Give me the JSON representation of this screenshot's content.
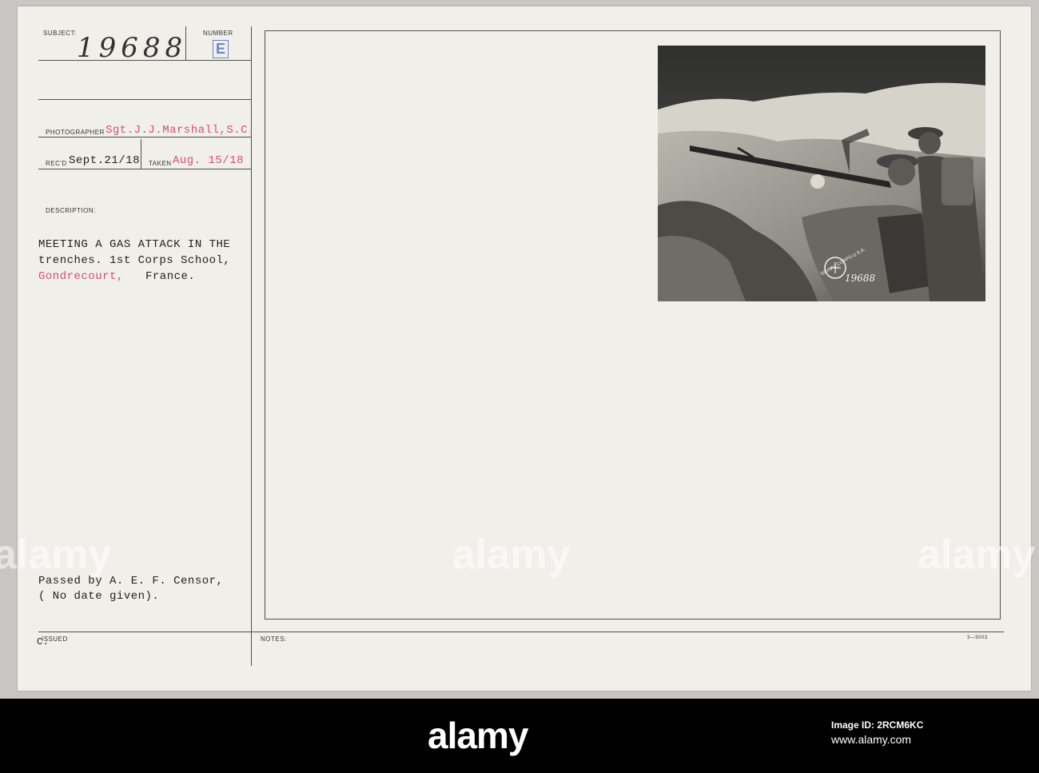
{
  "card": {
    "subject_label": "SUBJECT:",
    "subject_value": "19688",
    "number_label": "NUMBER",
    "number_value": "E",
    "photographer_label": "PHOTOGRAPHER",
    "photographer_value": "Sgt.J.J.Marshall,S.C.",
    "recd_label": "REC'D",
    "recd_value": "Sept.21/18",
    "taken_label": "TAKEN",
    "taken_value": "Aug. 15/18",
    "description_label": "DESCRIPTION:",
    "description_line1": "MEETING A GAS ATTACK IN THE",
    "description_line2": "trenches. 1st Corps School,",
    "description_place": "Gondrecourt,",
    "description_country": "France.",
    "censor_line1": "Passed by A. E. F. Censor,",
    "censor_line2": "( No date given).",
    "issued_label": "ISSUED",
    "issued_mark": "C.",
    "notes_label": "NOTES:",
    "form_number": "3—5003",
    "photo_number": "19688",
    "photo_seal": "SIGNAL CORPS U.S.A."
  },
  "watermarks": [
    "alamy",
    "alamy",
    "alamy"
  ],
  "footer": {
    "brand": "alamy",
    "image_id": "Image ID: 2RCM6KC",
    "url": "www.alamy.com"
  }
}
